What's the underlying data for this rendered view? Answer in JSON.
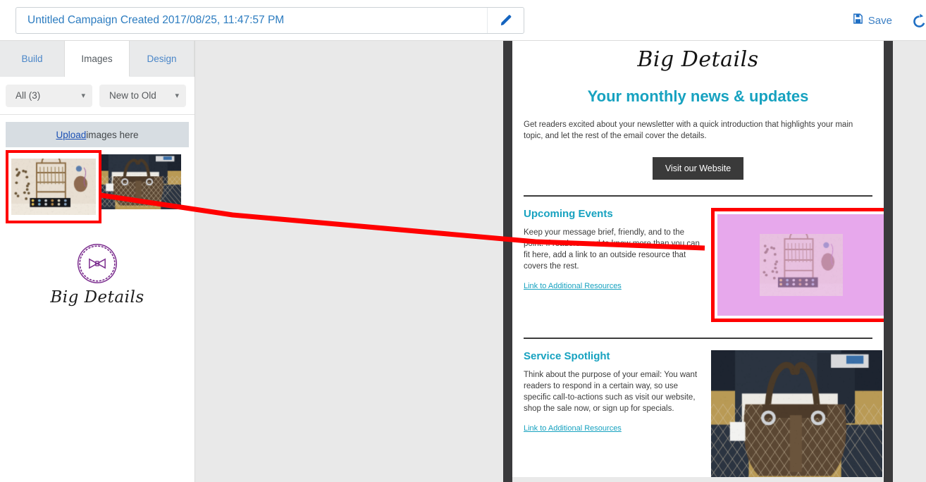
{
  "header": {
    "campaign_title": "Untitled Campaign Created 2017/08/25, 11:47:57 PM",
    "edit_icon": "pencil-icon",
    "save_label": "Save",
    "save_icon": "floppy-disk-save-icon",
    "undo_icon": "undo-arrow-icon",
    "accent_color": "#2c7cc0"
  },
  "sidebar": {
    "tabs": [
      {
        "label": "Build",
        "active": false
      },
      {
        "label": "Images",
        "active": true
      },
      {
        "label": "Design",
        "active": false
      }
    ],
    "filters": {
      "type_select": {
        "value": "All (3)",
        "caret_icon": "chevron-down-icon"
      },
      "sort_select": {
        "value": "New to Old",
        "caret_icon": "chevron-down-icon"
      }
    },
    "upload": {
      "link_label": "Upload",
      "rest_label": " images here"
    },
    "images": [
      {
        "name": "jewelry-display-rack",
        "selected": true,
        "alt": "Jewelry display rack with necklaces and rings"
      },
      {
        "name": "brown-quilted-handbag",
        "selected": false,
        "alt": "Brown quilted handbag on a chair"
      },
      {
        "name": "big-details-logo",
        "selected": false,
        "alt": "Big Details bow-tie logo",
        "caption": "Big Details"
      }
    ]
  },
  "email_preview": {
    "brand": "Big Details",
    "headline": "Your monthly news & updates",
    "headline_color": "#17a2c0",
    "intro": "Get readers excited about your newsletter with a quick introduction that highlights your main topic, and let the rest of the email cover the details.",
    "cta_button": "Visit our Website",
    "sections": [
      {
        "heading": "Upcoming Events",
        "body": "Keep your message brief, friendly, and to the point. If readers need to know more than you can fit here, add a link to an outside resource that covers the rest.",
        "link": "Link to Additional Resources",
        "media": "drop-target-highlighted"
      },
      {
        "heading": "Service Spotlight",
        "body": "Think about the purpose of your email: You want readers to respond in a certain way, so use specific call-to-actions such as visit our website, shop the sale now, or sign up for specials.",
        "link": "Link to Additional Resources",
        "media": "brown-quilted-handbag"
      }
    ]
  },
  "drag_action": {
    "source": "jewelry-display-rack thumbnail",
    "destination": "Upcoming Events image placeholder",
    "arrow_color": "#ff0000",
    "drop_highlight_color": "#e7a8ec"
  }
}
